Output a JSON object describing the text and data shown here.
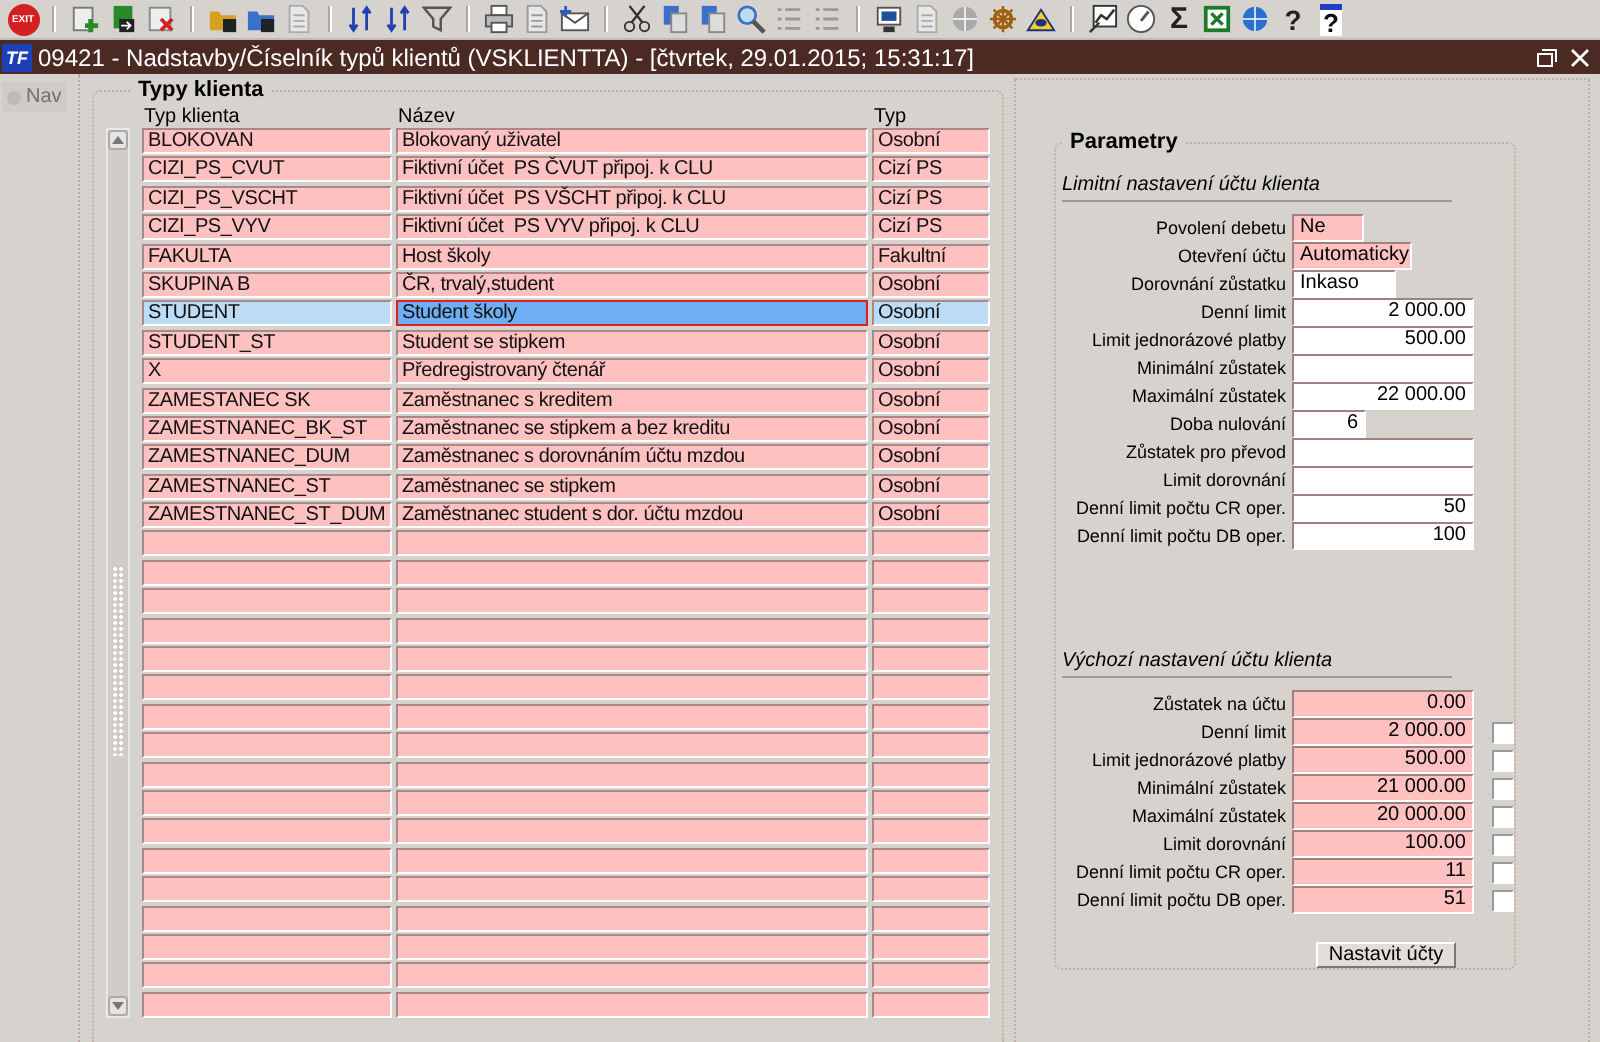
{
  "toolbar": {
    "exit_label": "EXIT",
    "sum_label": "Σ",
    "help_label": "?"
  },
  "window": {
    "logo_text": "TF",
    "title": "09421 - Nadstavby/Číselník typů klientů (VSKLIENTTA) - [čtvrtek, 29.01.2015; 15:31:17]"
  },
  "nav_button": {
    "label": "Nav",
    "disabled": true
  },
  "client_types": {
    "title": "Typy klienta",
    "columns": [
      "Typ klienta",
      "Název",
      "Typ"
    ],
    "rows": [
      {
        "code": "BLOKOVAN",
        "name": "Blokovaný uživatel",
        "type": "Osobní",
        "selected": false
      },
      {
        "code": "CIZI_PS_CVUT",
        "name": "Fiktivní účet  PS ČVUT připoj. k CLU",
        "type": "Cizí PS",
        "selected": false
      },
      {
        "code": "CIZI_PS_VSCHT",
        "name": "Fiktivní účet  PS VŠCHT připoj. k CLU",
        "type": "Cizí PS",
        "selected": false
      },
      {
        "code": "CIZI_PS_VYV",
        "name": "Fiktivní účet  PS VYV připoj. k CLU",
        "type": "Cizí PS",
        "selected": false
      },
      {
        "code": "FAKULTA",
        "name": "Host školy",
        "type": "Fakultní",
        "selected": false
      },
      {
        "code": "SKUPINA B",
        "name": "ČR, trvalý,student",
        "type": "Osobní",
        "selected": false
      },
      {
        "code": "STUDENT",
        "name": "Student školy",
        "type": "Osobní",
        "selected": true
      },
      {
        "code": "STUDENT_ST",
        "name": "Student se stipkem",
        "type": "Osobní",
        "selected": false
      },
      {
        "code": "X",
        "name": "Předregistrovaný čtenář",
        "type": "Osobní",
        "selected": false
      },
      {
        "code": "ZAMESTANEC SK",
        "name": "Zaměstnanec s kreditem",
        "type": "Osobní",
        "selected": false
      },
      {
        "code": "ZAMESTNANEC_BK_ST",
        "name": "Zaměstnanec se stipkem a bez kreditu",
        "type": "Osobní",
        "selected": false
      },
      {
        "code": "ZAMESTNANEC_DUM",
        "name": "Zaměstnanec s dorovnáním účtu mzdou",
        "type": "Osobní",
        "selected": false
      },
      {
        "code": "ZAMESTNANEC_ST",
        "name": "Zaměstnanec se stipkem",
        "type": "Osobní",
        "selected": false
      },
      {
        "code": "ZAMESTNANEC_ST_DUM",
        "name": "Zaměstnanec student s dor. účtu mzdou",
        "type": "Osobní",
        "selected": false
      }
    ]
  },
  "parameters": {
    "title": "Parametry",
    "limits": {
      "heading": "Limitní nastavení účtu klienta",
      "fields": [
        {
          "label": "Povolení debetu",
          "value": "Ne",
          "kind": "choice",
          "required": true
        },
        {
          "label": "Otevření účtu",
          "value": "Automaticky",
          "kind": "choice",
          "required": true
        },
        {
          "label": "Dorovnání zůstatku",
          "value": "Inkaso",
          "kind": "choice",
          "required": false
        },
        {
          "label": "Denní limit",
          "value": "2 000.00",
          "kind": "number",
          "required": false
        },
        {
          "label": "Limit jednorázové platby",
          "value": "500.00",
          "kind": "number",
          "required": false
        },
        {
          "label": "Minimální zůstatek",
          "kind": "number",
          "required": false
        },
        {
          "label": "Maximální zůstatek",
          "value": "22 000.00",
          "kind": "number",
          "required": false
        },
        {
          "label": "Doba nulování",
          "value": "6",
          "kind": "number",
          "required": false
        },
        {
          "label": "Zůstatek pro převod",
          "kind": "number",
          "required": false
        },
        {
          "label": "Limit dorovnání",
          "kind": "number",
          "required": false
        },
        {
          "label": "Denní limit počtu CR oper.",
          "value": "50",
          "kind": "number",
          "required": false
        },
        {
          "label": "Denní limit počtu DB oper.",
          "value": "100",
          "kind": "number",
          "required": false
        }
      ]
    },
    "defaults": {
      "heading": "Výchozí nastavení účtu klienta",
      "fields": [
        {
          "label": "Zůstatek na účtu",
          "value": "0.00",
          "kind": "number",
          "required": true
        },
        {
          "label": "Denní limit",
          "value": "2 000.00",
          "kind": "number",
          "required": true,
          "checked": false
        },
        {
          "label": "Limit jednorázové platby",
          "value": "500.00",
          "kind": "number",
          "required": true,
          "checked": false
        },
        {
          "label": "Minimální zůstatek",
          "value": "21 000.00",
          "kind": "number",
          "required": true,
          "checked": false
        },
        {
          "label": "Maximální zůstatek",
          "value": "20 000.00",
          "kind": "number",
          "required": true,
          "checked": false
        },
        {
          "label": "Limit dorovnání",
          "value": "100.00",
          "kind": "number",
          "required": true,
          "checked": false
        },
        {
          "label": "Denní limit počtu CR oper.",
          "value": "11",
          "kind": "number",
          "required": true,
          "checked": false
        },
        {
          "label": "Denní limit počtu DB oper.",
          "value": "51",
          "kind": "number",
          "required": true,
          "checked": false
        }
      ]
    },
    "button": "Nastavit účty"
  }
}
